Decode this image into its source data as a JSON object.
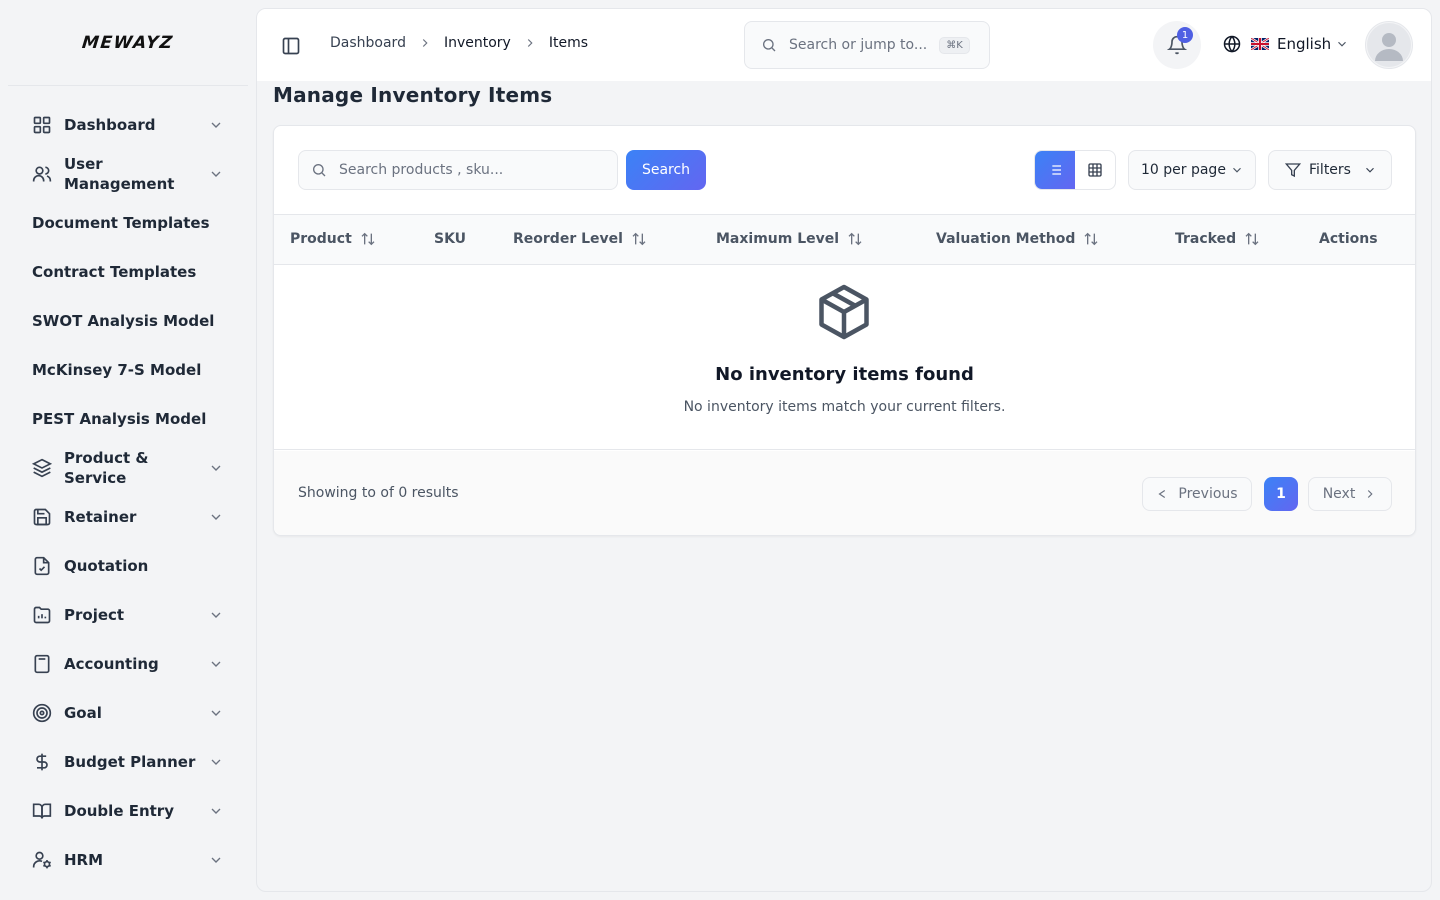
{
  "brand": {
    "logo": "MEWAYZ"
  },
  "sidebar": {
    "items": [
      {
        "label": "Dashboard",
        "icon": "dashboard-grid-icon",
        "has_children": true
      },
      {
        "label": "User Management",
        "icon": "users-icon",
        "has_children": true
      },
      {
        "label": "Document Templates",
        "icon": "",
        "has_children": false
      },
      {
        "label": "Contract Templates",
        "icon": "",
        "has_children": false
      },
      {
        "label": "SWOT Analysis Model",
        "icon": "",
        "has_children": false
      },
      {
        "label": "McKinsey 7-S Model",
        "icon": "",
        "has_children": false
      },
      {
        "label": "PEST Analysis Model",
        "icon": "",
        "has_children": false
      },
      {
        "label": "Product & Service",
        "icon": "layers-icon",
        "has_children": true
      },
      {
        "label": "Retainer",
        "icon": "save-icon",
        "has_children": true
      },
      {
        "label": "Quotation",
        "icon": "file-check-icon",
        "has_children": false
      },
      {
        "label": "Project",
        "icon": "folder-chart-icon",
        "has_children": true
      },
      {
        "label": "Accounting",
        "icon": "calculator-icon",
        "has_children": true
      },
      {
        "label": "Goal",
        "icon": "target-icon",
        "has_children": true
      },
      {
        "label": "Budget Planner",
        "icon": "dollar-icon",
        "has_children": true
      },
      {
        "label": "Double Entry",
        "icon": "book-open-icon",
        "has_children": true
      },
      {
        "label": "HRM",
        "icon": "user-cog-icon",
        "has_children": true
      }
    ]
  },
  "topbar": {
    "breadcrumbs": [
      "Dashboard",
      "Inventory",
      "Items"
    ],
    "jump_placeholder": "Search or jump to...",
    "jump_shortcut": "⌘K",
    "notification_count": "1",
    "language": "English",
    "language_flag": "🇬🇧"
  },
  "page": {
    "title": "Manage Inventory Items"
  },
  "toolbar": {
    "search_placeholder": "Search products , sku...",
    "search_button": "Search",
    "per_page": "10 per page",
    "filters": "Filters"
  },
  "table": {
    "columns": [
      {
        "label": "Product",
        "sortable": true
      },
      {
        "label": "SKU",
        "sortable": false
      },
      {
        "label": "Reorder Level",
        "sortable": true
      },
      {
        "label": "Maximum Level",
        "sortable": true
      },
      {
        "label": "Valuation Method",
        "sortable": true
      },
      {
        "label": "Tracked",
        "sortable": true
      },
      {
        "label": "Actions",
        "sortable": false
      }
    ],
    "rows": [],
    "empty_title": "No inventory items found",
    "empty_subtitle": "No inventory items match your current filters."
  },
  "pagination": {
    "summary": "Showing to of 0 results",
    "previous": "Previous",
    "next": "Next",
    "current_page": "1"
  },
  "colors": {
    "accent_start": "#3b82f6",
    "accent_end": "#6366f1",
    "badge": "#4f5fe3"
  }
}
